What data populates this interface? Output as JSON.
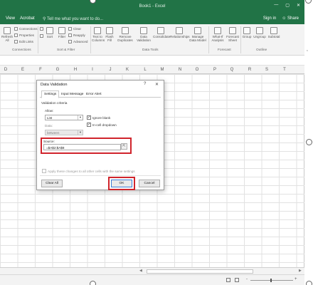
{
  "window": {
    "title": "Book1 - Excel",
    "controls": [
      "—",
      "▢",
      "✕"
    ]
  },
  "menu": {
    "tabs": [
      "View",
      "Acrobat"
    ],
    "tell_me": "Tell me what you want to do...",
    "sign_in": "Sign in",
    "share": "Share"
  },
  "ribbon": {
    "get_data": {
      "refresh_all": "Refresh All",
      "connections": "Connections",
      "properties": "Properties",
      "edit_links": "Edit Links",
      "group": "Connections"
    },
    "sort_filter": {
      "sort": "Sort",
      "filter": "Filter",
      "clear": "Clear",
      "reapply": "Reapply",
      "advanced": "Advanced",
      "group": "Sort & Filter"
    },
    "data_tools": {
      "text_to_columns": "Text to Columns",
      "flash_fill": "Flash Fill",
      "remove_duplicates": "Remove Duplicates",
      "data_validation": "Data Validation",
      "consolidate": "Consolidate",
      "relationships": "Relationships",
      "manage_data_model": "Manage Data Model",
      "group": "Data Tools"
    },
    "forecast": {
      "what_if": "What-If Analysis",
      "forecast_sheet": "Forecast Sheet",
      "group": "Forecast"
    },
    "outline": {
      "group_btn": "Group",
      "ungroup": "Ungroup",
      "subtotal": "Subtotal",
      "group": "Outline"
    }
  },
  "columns": [
    "D",
    "E",
    "F",
    "G",
    "H",
    "I",
    "J",
    "K",
    "L",
    "M",
    "N",
    "O",
    "P",
    "Q",
    "R",
    "S",
    "T"
  ],
  "dialog": {
    "title": "Data Validation",
    "help": "?",
    "close": "✕",
    "tabs": [
      "Settings",
      "Input Message",
      "Error Alert"
    ],
    "section": "Validation criteria",
    "allow_label": "Allow:",
    "allow_value": "List",
    "data_label": "Data:",
    "data_value": "between",
    "ignore_blank": "Ignore blank",
    "in_cell_dropdown": "In-cell dropdown",
    "source_label": "Source:",
    "source_value": "=$A$2:$A$8",
    "apply_all": "Apply these changes to all other cells with the same settings",
    "clear_all": "Clear All",
    "ok": "OK",
    "cancel": "Cancel"
  },
  "colors": {
    "excel_green": "#217346",
    "highlight_red": "#d0242c"
  }
}
